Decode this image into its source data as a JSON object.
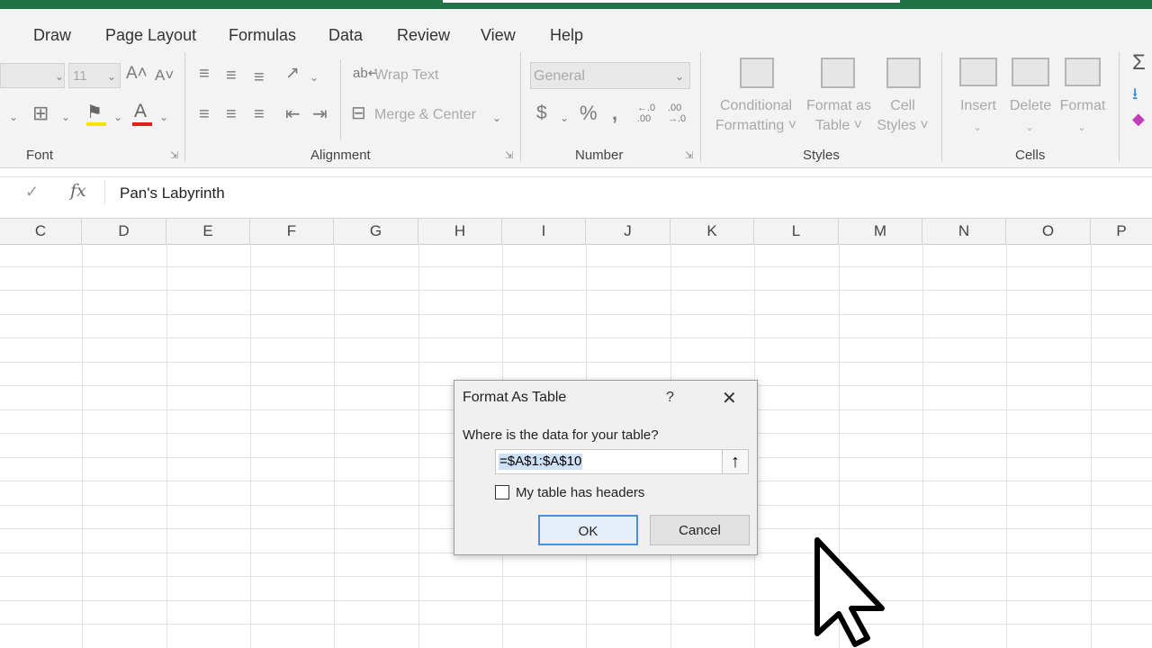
{
  "menu_tabs": [
    "Draw",
    "Page Layout",
    "Formulas",
    "Data",
    "Review",
    "View",
    "Help"
  ],
  "font_group": {
    "font_size": "11",
    "grow_icon": "A˄",
    "shrink_icon": "A˅",
    "label": "Font"
  },
  "alignment_group": {
    "wrap_text": "Wrap Text",
    "merge_center": "Merge & Center",
    "label": "Alignment"
  },
  "number_group": {
    "format": "General",
    "currency": "$",
    "percent": "%",
    "comma": "ஜ",
    "inc_decimal": "←.0\n.00",
    "dec_decimal": ".00\n→.0",
    "label": "Number"
  },
  "styles_group": {
    "conditional_line1": "Conditional",
    "conditional_line2": "Formatting ˅",
    "format_table_line1": "Format as",
    "format_table_line2": "Table ˅",
    "cell_styles_line1": "Cell",
    "cell_styles_line2": "Styles ˅",
    "label": "Styles"
  },
  "cells_group": {
    "insert": "Insert",
    "delete": "Delete",
    "format": "Format",
    "label": "Cells"
  },
  "editing_group": {
    "autosum": "Σ"
  },
  "formula_bar": {
    "cancel": "✓",
    "fx": "fx",
    "value": "Pan's Labyrinth"
  },
  "columns": [
    "C",
    "D",
    "E",
    "F",
    "G",
    "H",
    "I",
    "J",
    "K",
    "L",
    "M",
    "N",
    "O",
    "P"
  ],
  "dialog": {
    "title": "Format As Table",
    "help": "?",
    "close": "✕",
    "question": "Where is the data for your table?",
    "range": "=$A$1:$A$10",
    "range_button": "🡅",
    "headers_label": "My table has headers",
    "headers_checked": false,
    "ok": "OK",
    "cancel": "Cancel"
  },
  "colors": {
    "excel_green": "#217346",
    "ribbon_bg": "#f3f3f3",
    "disabled_text": "#a9a9a9",
    "ok_border": "#4a90d9"
  }
}
